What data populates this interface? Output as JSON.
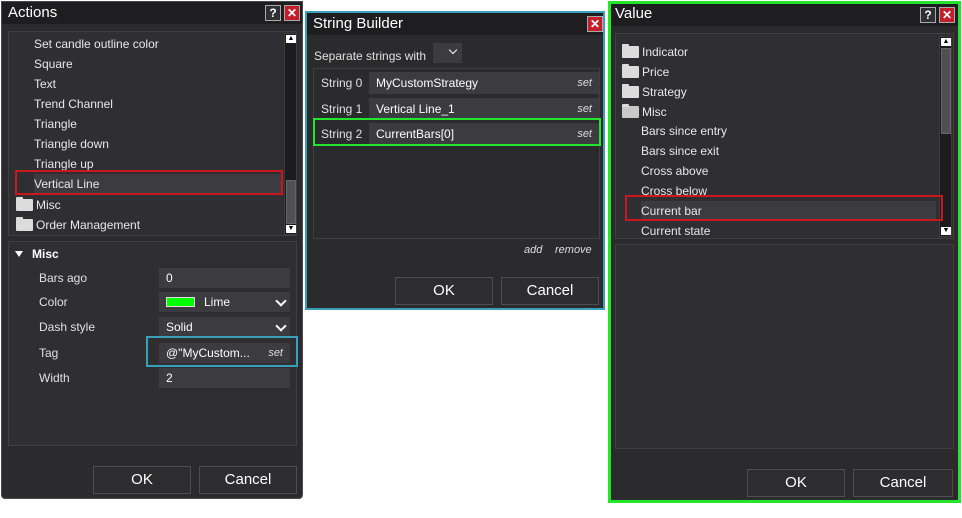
{
  "actions": {
    "title": "Actions",
    "help": "?",
    "close": "✕",
    "list": [
      "Set candle outline color",
      "Square",
      "Text",
      "Trend Channel",
      "Triangle",
      "Triangle down",
      "Triangle up",
      "Vertical Line"
    ],
    "folders": [
      "Misc",
      "Order Management"
    ],
    "section_title": "Misc",
    "props": {
      "bars_ago_label": "Bars ago",
      "bars_ago_value": "0",
      "color_label": "Color",
      "color_value": "Lime",
      "color_swatch": "#00ff00",
      "dash_label": "Dash style",
      "dash_value": "Solid",
      "tag_label": "Tag",
      "tag_value": "@\"MyCustom...",
      "tag_set": "set",
      "width_label": "Width",
      "width_value": "2"
    },
    "ok": "OK",
    "cancel": "Cancel"
  },
  "string_builder": {
    "title": "String Builder",
    "close": "✕",
    "separate_label": "Separate strings with",
    "rows": [
      {
        "label": "String 0",
        "value": "MyCustomStrategy",
        "set": "set"
      },
      {
        "label": "String 1",
        "value": "Vertical Line_1",
        "set": "set"
      },
      {
        "label": "String 2",
        "value": "CurrentBars[0]",
        "set": "set"
      }
    ],
    "add": "add",
    "remove": "remove",
    "ok": "OK",
    "cancel": "Cancel"
  },
  "value": {
    "title": "Value",
    "help": "?",
    "close": "✕",
    "folders": [
      "Indicator",
      "Price",
      "Strategy",
      "Misc"
    ],
    "items": [
      "Bars since entry",
      "Bars since exit",
      "Cross above",
      "Cross below",
      "Current bar",
      "Current state"
    ],
    "ok": "OK",
    "cancel": "Cancel"
  },
  "colors": {
    "highlight_red": "#c8191f",
    "highlight_green": "#22e52c",
    "highlight_teal": "#3a9fb8",
    "close_red": "#c41e2a",
    "window_bg": "#2b2b2e"
  }
}
